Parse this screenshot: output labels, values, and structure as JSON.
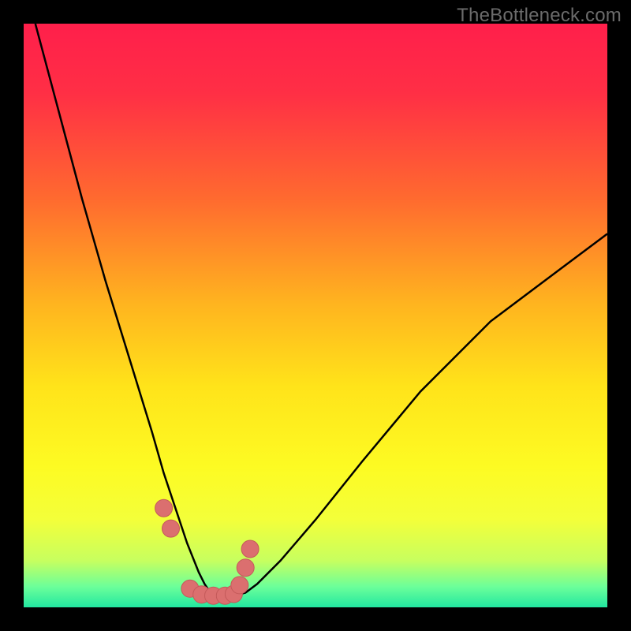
{
  "watermark": "TheBottleneck.com",
  "colors": {
    "frame": "#000000",
    "gradient_stops": [
      {
        "offset": 0,
        "color": "#ff1f4b"
      },
      {
        "offset": 0.12,
        "color": "#ff2f45"
      },
      {
        "offset": 0.3,
        "color": "#ff6a2f"
      },
      {
        "offset": 0.48,
        "color": "#ffb41f"
      },
      {
        "offset": 0.62,
        "color": "#ffe31a"
      },
      {
        "offset": 0.76,
        "color": "#fdfb23"
      },
      {
        "offset": 0.85,
        "color": "#f3ff3a"
      },
      {
        "offset": 0.92,
        "color": "#c7ff5f"
      },
      {
        "offset": 0.965,
        "color": "#6bff9a"
      },
      {
        "offset": 1.0,
        "color": "#22e7a0"
      }
    ],
    "curve": "#000000",
    "marker_fill": "#db6f6f",
    "marker_stroke": "#c45a5a"
  },
  "chart_data": {
    "type": "line",
    "title": "",
    "xlabel": "",
    "ylabel": "",
    "xlim": [
      0,
      100
    ],
    "ylim": [
      0,
      100
    ],
    "series": [
      {
        "name": "bottleneck-curve",
        "x_norm": [
          2,
          6,
          10,
          14,
          18,
          22,
          24,
          26,
          28,
          30,
          31,
          32,
          33,
          34,
          36,
          38,
          40,
          44,
          50,
          58,
          68,
          80,
          92,
          100
        ],
        "y_norm": [
          100,
          85,
          70,
          56,
          43,
          30,
          23,
          17,
          11,
          6,
          4,
          2.5,
          2,
          2,
          2,
          2.5,
          4,
          8,
          15,
          25,
          37,
          49,
          58,
          64
        ]
      }
    ],
    "markers": {
      "name": "highlight-points",
      "x_norm": [
        24.0,
        25.2,
        28.5,
        30.5,
        32.5,
        34.5,
        36.0,
        37.0,
        38.0,
        38.8
      ],
      "y_norm": [
        17.0,
        13.5,
        3.2,
        2.2,
        2.0,
        2.0,
        2.3,
        3.8,
        6.8,
        10.0
      ]
    }
  }
}
